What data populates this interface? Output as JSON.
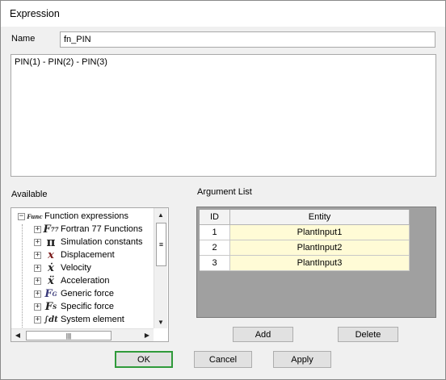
{
  "window": {
    "title": "Expression"
  },
  "name": {
    "label": "Name",
    "value": "fn_PIN"
  },
  "expression": {
    "text": "PIN(1) - PIN(2) - PIN(3)"
  },
  "available": {
    "label": "Available",
    "root": {
      "label": "Function expressions",
      "glyph": "Func"
    },
    "items": [
      {
        "label": "Fortran 77 Functions",
        "glyph": "F77",
        "icon": "fortran-icon"
      },
      {
        "label": "Simulation constants",
        "glyph": "π",
        "icon": "pi-icon"
      },
      {
        "label": "Displacement",
        "glyph": "x",
        "icon": "displacement-icon"
      },
      {
        "label": "Velocity",
        "glyph": "ẋ",
        "icon": "velocity-icon"
      },
      {
        "label": "Acceleration",
        "glyph": "ẍ",
        "icon": "acceleration-icon"
      },
      {
        "label": "Generic force",
        "glyph": "FG",
        "icon": "generic-force-icon"
      },
      {
        "label": "Specific force",
        "glyph": "FS",
        "icon": "specific-force-icon"
      },
      {
        "label": "System element",
        "glyph": "∫dt",
        "icon": "integral-icon"
      }
    ]
  },
  "argument_list": {
    "label": "Argument List",
    "columns": [
      "ID",
      "Entity"
    ],
    "rows": [
      {
        "id": "1",
        "entity": "PlantInput1"
      },
      {
        "id": "2",
        "entity": "PlantInput2"
      },
      {
        "id": "3",
        "entity": "PlantInput3"
      }
    ]
  },
  "buttons": {
    "add": "Add",
    "delete": "Delete",
    "ok": "OK",
    "cancel": "Cancel",
    "apply": "Apply"
  }
}
